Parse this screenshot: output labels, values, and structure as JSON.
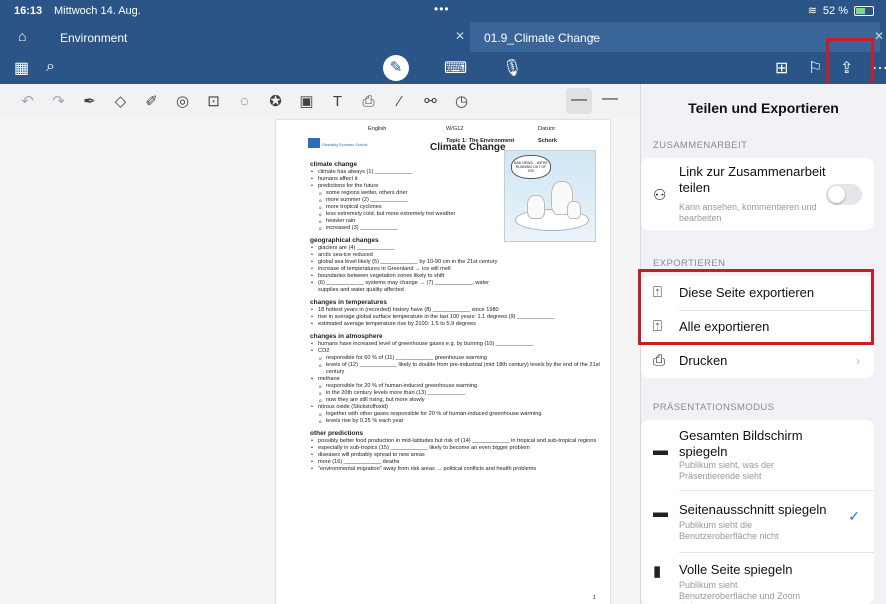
{
  "status_bar": {
    "time": "16:13",
    "date": "Mittwoch 14. Aug.",
    "battery": "52 %"
  },
  "tabs": {
    "home_tab": "Environment",
    "active_tab": "01.9_Climate Change"
  },
  "document": {
    "header_left": "English",
    "header_mid": "W/G12",
    "header_right": "Datum:",
    "topic": "Topic 1: The Environment",
    "author": "Schork",
    "title": "Climate Change",
    "logo_text": "Gestaltig Schwarz Schule",
    "cartoon_caption": "BAD NEWS... WE'RE RUNNING OUT OF ICE!",
    "page_number": "1",
    "sections": [
      {
        "heading": "climate change",
        "items": [
          {
            "t": "climate has always (1) ____________",
            "s": false
          },
          {
            "t": "humans affect it",
            "s": false
          },
          {
            "t": "predictions for the future",
            "s": false
          },
          {
            "t": "some regions wetter, others drier",
            "s": true
          },
          {
            "t": "more summer (2) ____________",
            "s": true
          },
          {
            "t": "more tropical cyclones",
            "s": true
          },
          {
            "t": "less extremely cold, but more extremely hot weather",
            "s": true
          },
          {
            "t": "heavier rain",
            "s": true
          },
          {
            "t": "increased (3) ____________",
            "s": true
          }
        ]
      },
      {
        "heading": "geographical changes",
        "items": [
          {
            "t": "glaciers are (4) ____________",
            "s": false
          },
          {
            "t": "arctic sea-ice reduced",
            "s": false
          },
          {
            "t": "global sea level likely (5) ____________ by 10-90 cm in the 21st century",
            "s": false
          },
          {
            "t": "increase of temperatures in Greenland → ice will melt",
            "s": false
          },
          {
            "t": "boundaries between vegetation zones likely to shift",
            "s": false
          },
          {
            "t": "(6) ____________ systems may change → (7) ____________, water supplies and water quality affected",
            "s": false
          }
        ]
      },
      {
        "heading": "changes in temperatures",
        "items": [
          {
            "t": "18 hottest years in (recorded) history have (8) ____________ since 1980",
            "s": false
          },
          {
            "t": "rise in average global surface temperature in the last 100 years: 1.1 degrees (9) ____________",
            "s": false
          },
          {
            "t": "estimated average temperature rise by 2100: 1.5 to 5.9 degrees",
            "s": false
          }
        ]
      },
      {
        "heading": "changes in atmosphere",
        "items": [
          {
            "t": "humans have increased level of greenhouse gases e.g. by burning (10) ____________",
            "s": false
          },
          {
            "t": "CO2",
            "s": false
          },
          {
            "t": "responsible for 60 % of (11) ____________ greenhouse warming",
            "s": true
          },
          {
            "t": "levels of (12) ____________ likely to double from pre-industrial (mid 18th century) levels by the end of the 21st century",
            "s": true
          },
          {
            "t": "methane",
            "s": false
          },
          {
            "t": "responsible for 20 % of human-induced greenhouse warming",
            "s": true
          },
          {
            "t": "in the 20th century levels more than (13) ____________",
            "s": true
          },
          {
            "t": "now they are still rising, but more slowly",
            "s": true
          },
          {
            "t": "nitrous oxide (Stickstoffoxid)",
            "s": false
          },
          {
            "t": "together with other gases responsible for 20 % of human-induced greenhouse warming",
            "s": true
          },
          {
            "t": "levels rise by 0.25 % each year",
            "s": true
          }
        ]
      },
      {
        "heading": "other predictions",
        "items": [
          {
            "t": "possibly better food production in mid-latitudes but risk of (14) ____________ in tropical and sub-tropical regions",
            "s": false
          },
          {
            "t": "especially in sub-tropics (15) ____________ likely to become an even bigger problem",
            "s": false
          },
          {
            "t": "diseases will probably spread to new areas",
            "s": false
          },
          {
            "t": "more (16) ____________ deaths",
            "s": false
          },
          {
            "t": "\"environmental migration\" away from risk areas → political conflicts and health problems",
            "s": false
          }
        ]
      }
    ]
  },
  "panel": {
    "title": "Teilen und Exportieren",
    "collab_header": "ZUSAMMENARBEIT",
    "collab_link_label": "Link zur Zusammenarbeit teilen",
    "collab_link_sub": "Kann ansehen, kommentieren und bearbeiten",
    "export_header": "EXPORTIEREN",
    "export_page": "Diese Seite exportieren",
    "export_all": "Alle exportieren",
    "print": "Drucken",
    "present_header": "PRÄSENTATIONSMODUS",
    "mirror_full": "Gesamten Bildschirm spiegeln",
    "mirror_full_sub": "Publikum sieht, was der Präsentierende sieht",
    "mirror_page": "Seitenausschnitt spiegeln",
    "mirror_page_sub": "Publikum sieht die Benutzeroberfläche nicht",
    "mirror_fullpage": "Volle Seite spiegeln",
    "mirror_fullpage_sub": "Publikum sieht Benutzeroberfläche und Zoom nicht"
  },
  "icons": {
    "highlight_color": "#c81e26",
    "bar_color": "#2a5586",
    "accent": "#1a6fe0"
  }
}
